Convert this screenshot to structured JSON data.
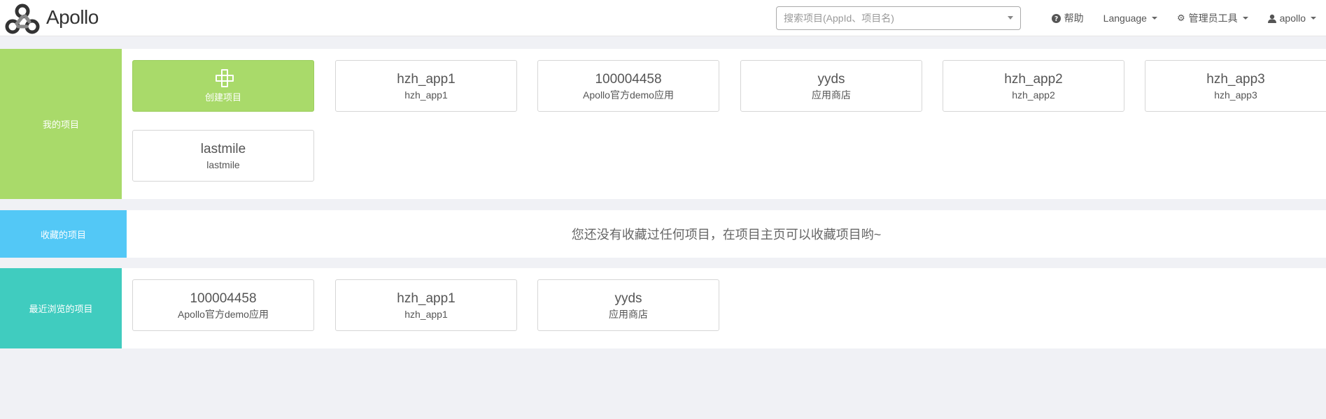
{
  "brand": {
    "name": "Apollo",
    "logo_icon": "apollo-logo-icon"
  },
  "search": {
    "placeholder": "搜索项目(AppId、项目名)"
  },
  "nav": {
    "help": {
      "label": "帮助",
      "icon": "question-circle-icon"
    },
    "language": {
      "label": "Language"
    },
    "admin_tools": {
      "label": "管理员工具",
      "icon": "gear-icon"
    },
    "user": {
      "label": "apollo",
      "icon": "user-icon"
    }
  },
  "my_projects": {
    "label": "我的项目",
    "create_label": "创建项目",
    "items": [
      {
        "appid": "hzh_app1",
        "name": "hzh_app1"
      },
      {
        "appid": "100004458",
        "name": "Apollo官方demo应用"
      },
      {
        "appid": "yyds",
        "name": "应用商店"
      },
      {
        "appid": "hzh_app2",
        "name": "hzh_app2"
      },
      {
        "appid": "hzh_app3",
        "name": "hzh_app3"
      },
      {
        "appid": "lastmile",
        "name": "lastmile"
      }
    ]
  },
  "favorites": {
    "label": "收藏的项目",
    "empty_message": "您还没有收藏过任何项目，在项目主页可以收藏项目哟~"
  },
  "recent": {
    "label": "最近浏览的项目",
    "items": [
      {
        "appid": "100004458",
        "name": "Apollo官方demo应用"
      },
      {
        "appid": "hzh_app1",
        "name": "hzh_app1"
      },
      {
        "appid": "yyds",
        "name": "应用商店"
      }
    ]
  },
  "colors": {
    "my_projects_accent": "#a9da6a",
    "favorites_accent": "#53c8f6",
    "recent_accent": "#40ccbf",
    "page_background": "#f0f1f5"
  }
}
